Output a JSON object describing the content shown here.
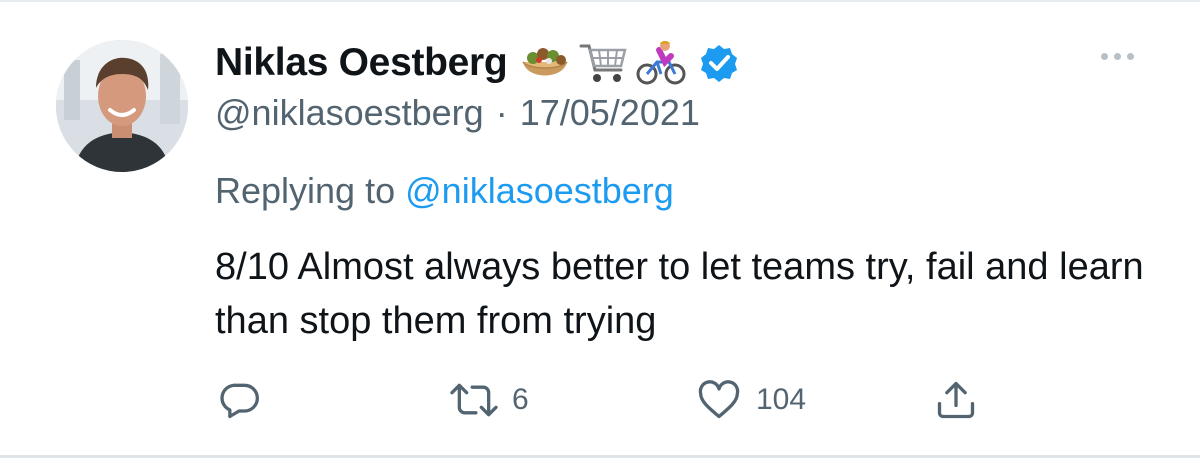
{
  "tweet": {
    "author": {
      "display_name": "Niklas Oestberg",
      "handle": "@niklasoestberg",
      "emojis": [
        "falafel-wrap-emoji",
        "shopping-cart-emoji",
        "woman-biking-emoji"
      ],
      "verified": true
    },
    "separator": "·",
    "date": "17/05/2021",
    "replying_prefix": "Replying to",
    "replying_to": "@niklasoestberg",
    "text": "8/10 Almost always better to let teams try, fail and learn than stop them from trying",
    "actions": {
      "reply": {
        "icon": "reply-icon",
        "count": ""
      },
      "retweet": {
        "icon": "retweet-icon",
        "count": "6"
      },
      "like": {
        "icon": "heart-icon",
        "count": "104"
      },
      "share": {
        "icon": "share-icon"
      }
    }
  },
  "colors": {
    "text_primary": "#0f1419",
    "text_secondary": "#536471",
    "link": "#1d9bf0",
    "verified": "#1d9bf0"
  }
}
